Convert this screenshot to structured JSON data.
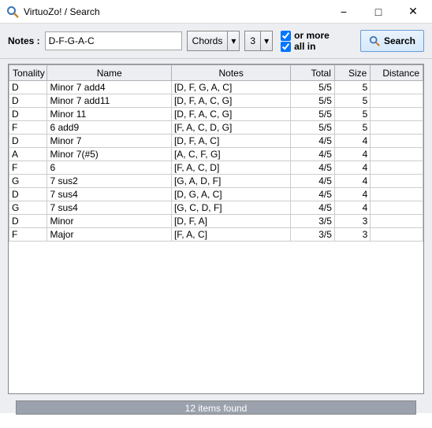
{
  "window": {
    "title": "VirtuoZo! / Search"
  },
  "toolbar": {
    "notes_label": "Notes :",
    "notes_value": "D-F-G-A-C",
    "mode": "Chords",
    "count": "3",
    "or_more_label": "or more",
    "or_more_checked": true,
    "all_in_label": "all in",
    "all_in_checked": true,
    "search_label": "Search"
  },
  "columns": {
    "tonality": "Tonality",
    "name": "Name",
    "notes": "Notes",
    "total": "Total",
    "size": "Size",
    "distance": "Distance"
  },
  "rows": [
    {
      "tonality": "D",
      "name": "Minor 7 add4",
      "notes": "[D, F, G, A, C]",
      "total": "5/5",
      "size": "5",
      "distance": ""
    },
    {
      "tonality": "D",
      "name": "Minor 7 add11",
      "notes": "[D, F, A, C, G]",
      "total": "5/5",
      "size": "5",
      "distance": ""
    },
    {
      "tonality": "D",
      "name": "Minor 11",
      "notes": "[D, F, A, C, G]",
      "total": "5/5",
      "size": "5",
      "distance": ""
    },
    {
      "tonality": "F",
      "name": "6 add9",
      "notes": "[F, A, C, D, G]",
      "total": "5/5",
      "size": "5",
      "distance": ""
    },
    {
      "tonality": "D",
      "name": "Minor 7",
      "notes": "[D, F, A, C]",
      "total": "4/5",
      "size": "4",
      "distance": ""
    },
    {
      "tonality": "A",
      "name": "Minor 7(#5)",
      "notes": "[A, C, F, G]",
      "total": "4/5",
      "size": "4",
      "distance": ""
    },
    {
      "tonality": "F",
      "name": "6",
      "notes": "[F, A, C, D]",
      "total": "4/5",
      "size": "4",
      "distance": ""
    },
    {
      "tonality": "G",
      "name": "7 sus2",
      "notes": "[G, A, D, F]",
      "total": "4/5",
      "size": "4",
      "distance": ""
    },
    {
      "tonality": "D",
      "name": "7 sus4",
      "notes": "[D, G, A, C]",
      "total": "4/5",
      "size": "4",
      "distance": ""
    },
    {
      "tonality": "G",
      "name": "7 sus4",
      "notes": "[G, C, D, F]",
      "total": "4/5",
      "size": "4",
      "distance": ""
    },
    {
      "tonality": "D",
      "name": "Minor",
      "notes": "[D, F, A]",
      "total": "3/5",
      "size": "3",
      "distance": ""
    },
    {
      "tonality": "F",
      "name": "Major",
      "notes": "[F, A, C]",
      "total": "3/5",
      "size": "3",
      "distance": ""
    }
  ],
  "status": "12 items found"
}
